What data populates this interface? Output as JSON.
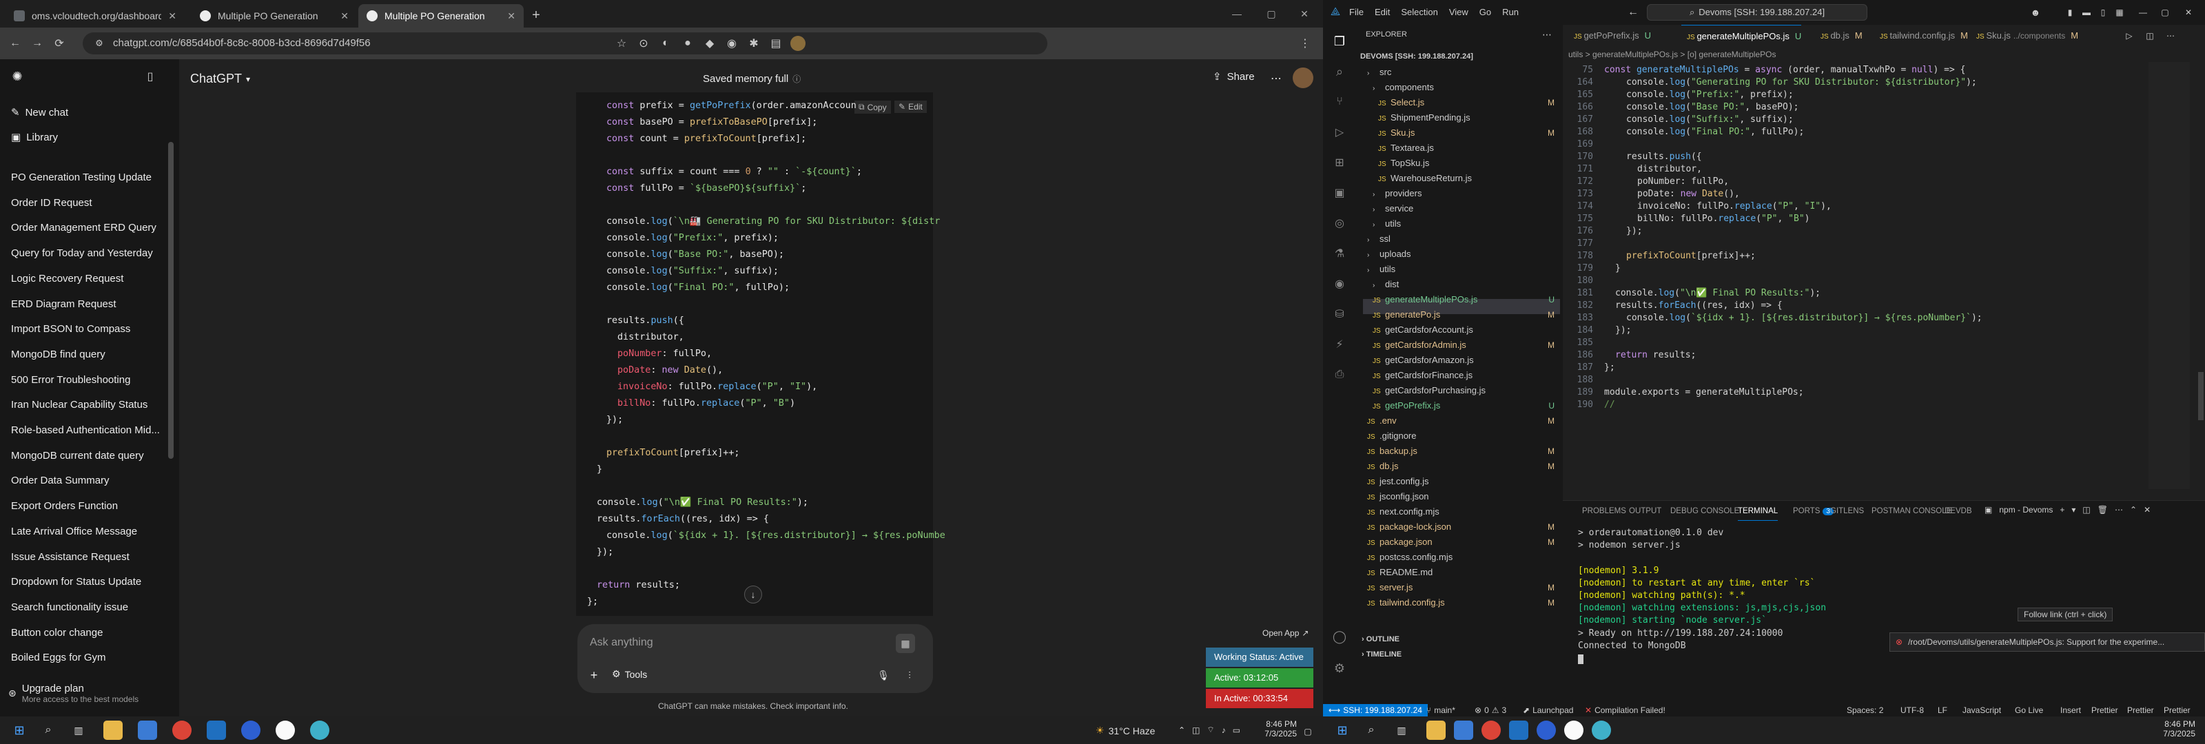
{
  "browser": {
    "tabs": [
      {
        "title": "oms.vcloudtech.org/dashboard"
      },
      {
        "title": "Multiple PO Generation"
      },
      {
        "title": "Multiple PO Generation"
      }
    ],
    "url": "chatgpt.com/c/685d4b0f-8c8c-8008-b3cd-8696d7d49f56"
  },
  "chatgpt": {
    "brand": "ChatGPT",
    "header_center": "Saved memory full",
    "share": "Share",
    "new_chat": "New chat",
    "library": "Library",
    "history": [
      "PO Generation Testing Update",
      "Order ID Request",
      "Order Management ERD Query",
      "Query for Today and Yesterday",
      "Logic Recovery Request",
      "ERD Diagram Request",
      "Import BSON to Compass",
      "MongoDB find query",
      "500 Error Troubleshooting",
      "Iran Nuclear Capability Status",
      "Role-based Authentication Mid...",
      "MongoDB current date query",
      "Order Data Summary",
      "Export Orders Function",
      "Late Arrival Office Message",
      "Issue Assistance Request",
      "Dropdown for Status Update",
      "Search functionality issue",
      "Button color change",
      "Boiled Eggs for Gym"
    ],
    "upgrade_title": "Upgrade plan",
    "upgrade_sub": "More access to the best models",
    "copy": "Copy",
    "edit": "Edit",
    "ask_placeholder": "Ask anything",
    "tools": "Tools",
    "disclaimer": "ChatGPT can make mistakes. Check important info.",
    "open_app": "Open App",
    "working_status": "Working Status: Active",
    "active_time": "Active: 03:12:05",
    "inactive_time": "In Active: 00:33:54"
  },
  "taskbar_left": {
    "weather": "31°C Haze",
    "time": "8:46 PM",
    "date": "7/3/2025"
  },
  "taskbar_right": {
    "time": "8:46 PM",
    "date": "7/3/2025"
  },
  "vscode": {
    "menu": [
      "File",
      "Edit",
      "Selection",
      "View",
      "Go",
      "Run"
    ],
    "command_center": "Devoms [SSH: 199.188.207.24]",
    "explorer_title": "EXPLORER",
    "root": "DEVOMS [SSH: 199.188.207.24]",
    "tabs": [
      "getPoPrefix.js",
      "generateMultiplePOs.js",
      "db.js",
      "tailwind.config.js",
      "Sku.js"
    ],
    "tab_flags": [
      "U",
      "U",
      "M",
      "M",
      "M"
    ],
    "tab_sku_path": "../components",
    "breadcrumb": "utils > generateMultiplePOs.js > [o] generateMultiplePOs",
    "files": [
      {
        "name": "src",
        "flag": ""
      },
      {
        "name": "components",
        "flag": ""
      },
      {
        "name": "Select.js",
        "flag": "M"
      },
      {
        "name": "ShipmentPending.js",
        "flag": ""
      },
      {
        "name": "Sku.js",
        "flag": "M"
      },
      {
        "name": "Textarea.js",
        "flag": ""
      },
      {
        "name": "TopSku.js",
        "flag": ""
      },
      {
        "name": "WarehouseReturn.js",
        "flag": ""
      },
      {
        "name": "providers",
        "flag": ""
      },
      {
        "name": "service",
        "flag": ""
      },
      {
        "name": "utils",
        "flag": ""
      },
      {
        "name": "ssl",
        "flag": ""
      },
      {
        "name": "uploads",
        "flag": ""
      },
      {
        "name": "utils",
        "flag": ""
      },
      {
        "name": "dist",
        "flag": ""
      },
      {
        "name": "generateMultiplePOs.js",
        "flag": "U"
      },
      {
        "name": "generatePo.js",
        "flag": "M"
      },
      {
        "name": "getCardsforAccount.js",
        "flag": ""
      },
      {
        "name": "getCardsforAdmin.js",
        "flag": "M"
      },
      {
        "name": "getCardsforAmazon.js",
        "flag": ""
      },
      {
        "name": "getCardsforFinance.js",
        "flag": ""
      },
      {
        "name": "getCardsforPurchasing.js",
        "flag": ""
      },
      {
        "name": "getPoPrefix.js",
        "flag": "U"
      },
      {
        "name": ".env",
        "flag": "M"
      },
      {
        "name": ".gitignore",
        "flag": ""
      },
      {
        "name": "backup.js",
        "flag": "M"
      },
      {
        "name": "db.js",
        "flag": "M"
      },
      {
        "name": "jest.config.js",
        "flag": ""
      },
      {
        "name": "jsconfig.json",
        "flag": ""
      },
      {
        "name": "next.config.mjs",
        "flag": ""
      },
      {
        "name": "package-lock.json",
        "flag": "M"
      },
      {
        "name": "package.json",
        "flag": "M"
      },
      {
        "name": "postcss.config.mjs",
        "flag": ""
      },
      {
        "name": "README.md",
        "flag": ""
      },
      {
        "name": "server.js",
        "flag": "M"
      },
      {
        "name": "tailwind.config.js",
        "flag": "M"
      }
    ],
    "outline": "OUTLINE",
    "timeline": "TIMELINE",
    "panel_tabs": [
      "PROBLEMS",
      "OUTPUT",
      "DEBUG CONSOLE",
      "TERMINAL",
      "PORTS",
      "GITLENS",
      "POSTMAN CONSOLE",
      "DEVDB"
    ],
    "ports_count": "3",
    "terminal_profile": "npm - Devoms",
    "terminal": [
      "> orderautomation@0.1.0 dev",
      "> nodemon server.js",
      "",
      "[nodemon] 3.1.9",
      "[nodemon] to restart at any time, enter `rs`",
      "[nodemon] watching path(s): *.*",
      "[nodemon] watching extensions: js,mjs,cjs,json",
      "[nodemon] starting `node server.js`",
      "> Ready on http://199.188.207.24:10000",
      "Connected to MongoDB"
    ],
    "follow_link": "Follow link (ctrl + click)",
    "notification": "/root/Devoms/utils/generateMultiplePOs.js: Support for the experime...",
    "status": {
      "remote": "SSH: 199.188.207.24",
      "branch": "main*",
      "errors": "0",
      "warnings": "3",
      "launchpad": "Launchpad",
      "compile": "Compilation Failed!",
      "spaces": "Spaces: 2",
      "encoding": "UTF-8",
      "eol": "LF",
      "lang": "JavaScript",
      "golive": "Go Live",
      "insert": "Insert",
      "prettier1": "Prettier",
      "prettier2": "Prettier",
      "prettier3": "Prettier"
    }
  }
}
